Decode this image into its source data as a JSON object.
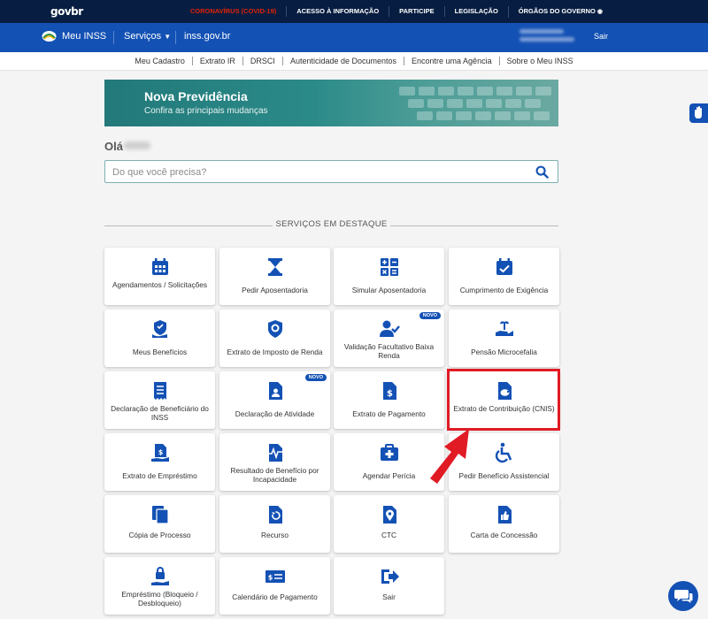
{
  "govbar": {
    "logo": "govbr",
    "links": [
      "CORONAVÍRUS (COVID-19)",
      "ACESSO À INFORMAÇÃO",
      "PARTICIPE",
      "LEGISLAÇÃO",
      "ÓRGÃOS DO GOVERNO"
    ]
  },
  "header": {
    "brand": "Meu INSS",
    "servicos": "Serviços",
    "domain": "inss.gov.br",
    "logout": "Sair"
  },
  "subnav": [
    "Meu Cadastro",
    "Extrato IR",
    "DRSCI",
    "Autenticidade de Documentos",
    "Encontre uma Agência",
    "Sobre o Meu INSS"
  ],
  "banner": {
    "title": "Nova Previdência",
    "subtitle": "Confira as principais mudanças"
  },
  "greeting": "Olá",
  "search": {
    "placeholder": "Do que você precisa?"
  },
  "section_title": "SERVIÇOS EM DESTAQUE",
  "badge_new": "NOVO",
  "cards": [
    {
      "label": "Agendamentos / Solicitações",
      "icon": "calendar-icon"
    },
    {
      "label": "Pedir Aposentadoria",
      "icon": "hourglass-icon"
    },
    {
      "label": "Simular Aposentadoria",
      "icon": "calculator-icon"
    },
    {
      "label": "Cumprimento de Exigência",
      "icon": "calendar-check-icon"
    },
    {
      "label": "Meus Benefícios",
      "icon": "shield-hand-icon"
    },
    {
      "label": "Extrato de Imposto de Renda",
      "icon": "lion-shield-icon"
    },
    {
      "label": "Validação Facultativo Baixa Renda",
      "icon": "user-check-icon",
      "badge": true
    },
    {
      "label": "Pensão Microcefalia",
      "icon": "hand-plant-icon"
    },
    {
      "label": "Declaração de Beneficiário do INSS",
      "icon": "receipt-icon"
    },
    {
      "label": "Declaração de Atividade",
      "icon": "id-document-icon",
      "badge": true
    },
    {
      "label": "Extrato de Pagamento",
      "icon": "dollar-document-icon"
    },
    {
      "label": "Extrato de Contribuição (CNIS)",
      "icon": "piggy-document-icon"
    },
    {
      "label": "Extrato de Empréstimo",
      "icon": "loan-document-icon"
    },
    {
      "label": "Resultado de Benefício por Incapacidade",
      "icon": "pulse-document-icon"
    },
    {
      "label": "Agendar Perícia",
      "icon": "medical-kit-icon"
    },
    {
      "label": "Pedir Benefício Assistencial",
      "icon": "wheelchair-icon"
    },
    {
      "label": "Cópia de Processo",
      "icon": "copy-icon"
    },
    {
      "label": "Recurso",
      "icon": "undo-document-icon"
    },
    {
      "label": "CTC",
      "icon": "pin-document-icon"
    },
    {
      "label": "Carta de Concessão",
      "icon": "thumbs-up-document-icon"
    },
    {
      "label": "Empréstimo (Bloqueio / Desbloqueio)",
      "icon": "lock-document-icon"
    },
    {
      "label": "Calendário de Pagamento",
      "icon": "money-bill-icon"
    },
    {
      "label": "Sair",
      "icon": "sign-out-icon"
    }
  ],
  "colors": {
    "primary": "#1351b4",
    "govbar": "#071d41",
    "highlight": "#e01b24"
  }
}
